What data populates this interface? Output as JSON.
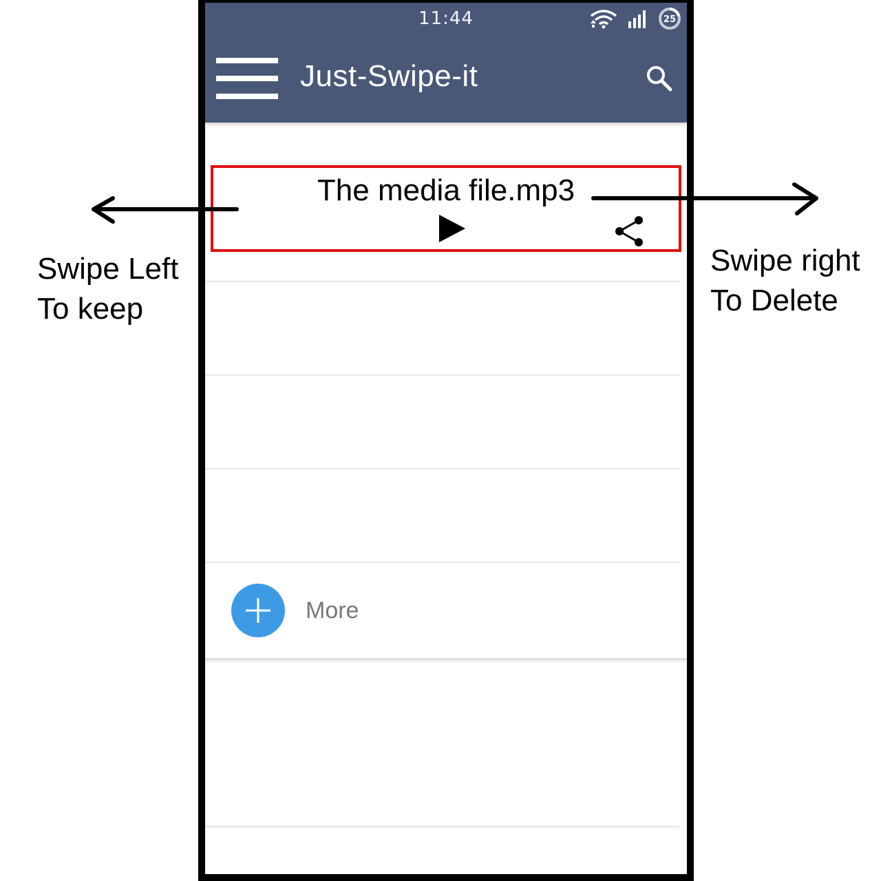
{
  "status_bar": {
    "time": "11:44",
    "battery_level": "25",
    "icons": [
      "wifi-icon",
      "signal-icon",
      "battery-icon"
    ]
  },
  "app_bar": {
    "title": "Just-Swipe-it",
    "menu_icon": "hamburger-menu-icon",
    "search_icon": "search-icon"
  },
  "media_item": {
    "file_name": "The media file.mp3",
    "play_icon": "play-icon",
    "share_icon": "share-icon"
  },
  "more_button": {
    "label": "More",
    "icon": "plus-icon"
  },
  "annotations": {
    "swipe_left_line1": "Swipe Left",
    "swipe_left_line2": "To keep",
    "swipe_right_line1": "Swipe right",
    "swipe_right_line2": "To Delete"
  },
  "colors": {
    "app_bar": "#4a5878",
    "highlight_border": "#e01010",
    "fab": "#3d9be6"
  }
}
